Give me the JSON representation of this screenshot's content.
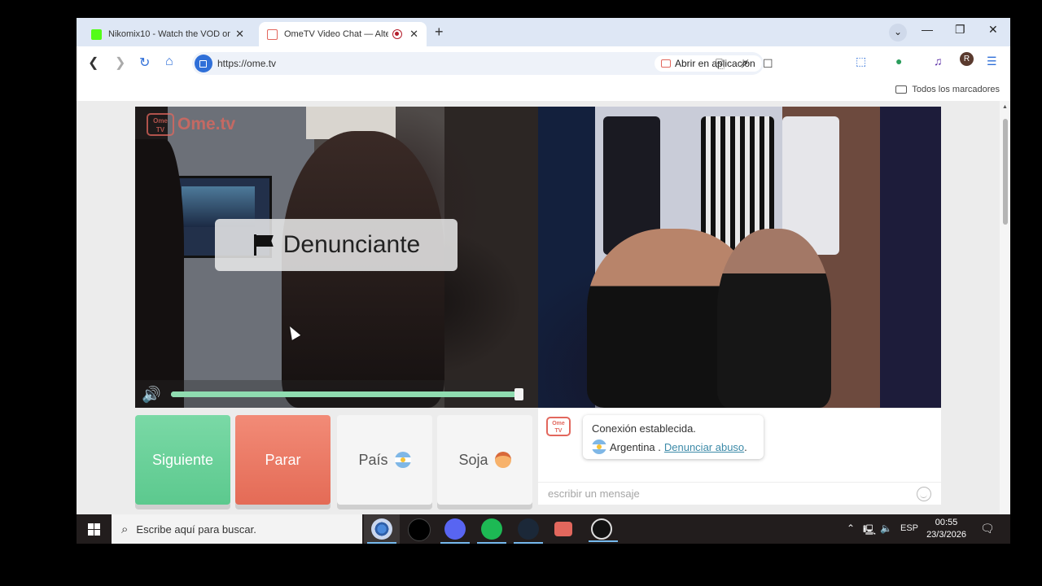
{
  "tabs": [
    {
      "title": "Nikomix10 - Watch the VOD on",
      "favicon_color": "#53fc18",
      "active": false
    },
    {
      "title": "OmeTV Video Chat — Alter",
      "favicon_color": "#e2675d",
      "active": true
    }
  ],
  "window_controls": {
    "tab_search": "⌄",
    "minimize": "—",
    "restore": "❐",
    "close": "✕",
    "new_tab": "+",
    "tab_close": "✕"
  },
  "address_bar": {
    "url": "https://ome.tv",
    "open_in_app": "Abrir en aplicación"
  },
  "bookmarks": {
    "all_bookmarks": "Todos los marcadores"
  },
  "profile_initial": "R",
  "video": {
    "logo_text": "Ome.tv",
    "logo_small": "Ome TV",
    "report_label": "Denunciante",
    "volume_fraction": 0.99
  },
  "controls": {
    "next": "Siguiente",
    "stop": "Parar",
    "country": "País",
    "gender": "Soja"
  },
  "chat": {
    "status": "Conexión establecida.",
    "country": "Argentina .",
    "report_link": "Denunciar abuso",
    "report_suffix": ".",
    "input_placeholder": "escribir un mensaje"
  },
  "taskbar": {
    "search_placeholder": "Escribe aquí para buscar.",
    "apps": [
      "chrome",
      "tiktok",
      "discord-obs",
      "spotify",
      "steam",
      "ometv",
      "obs"
    ],
    "language": "ESP",
    "time": "00:55",
    "date": "23/3/2026"
  },
  "colors": {
    "accent_green": "#6fd39c",
    "accent_red": "#ea7863",
    "brand_ometv": "#e2675d",
    "link": "#3c8aa8"
  }
}
